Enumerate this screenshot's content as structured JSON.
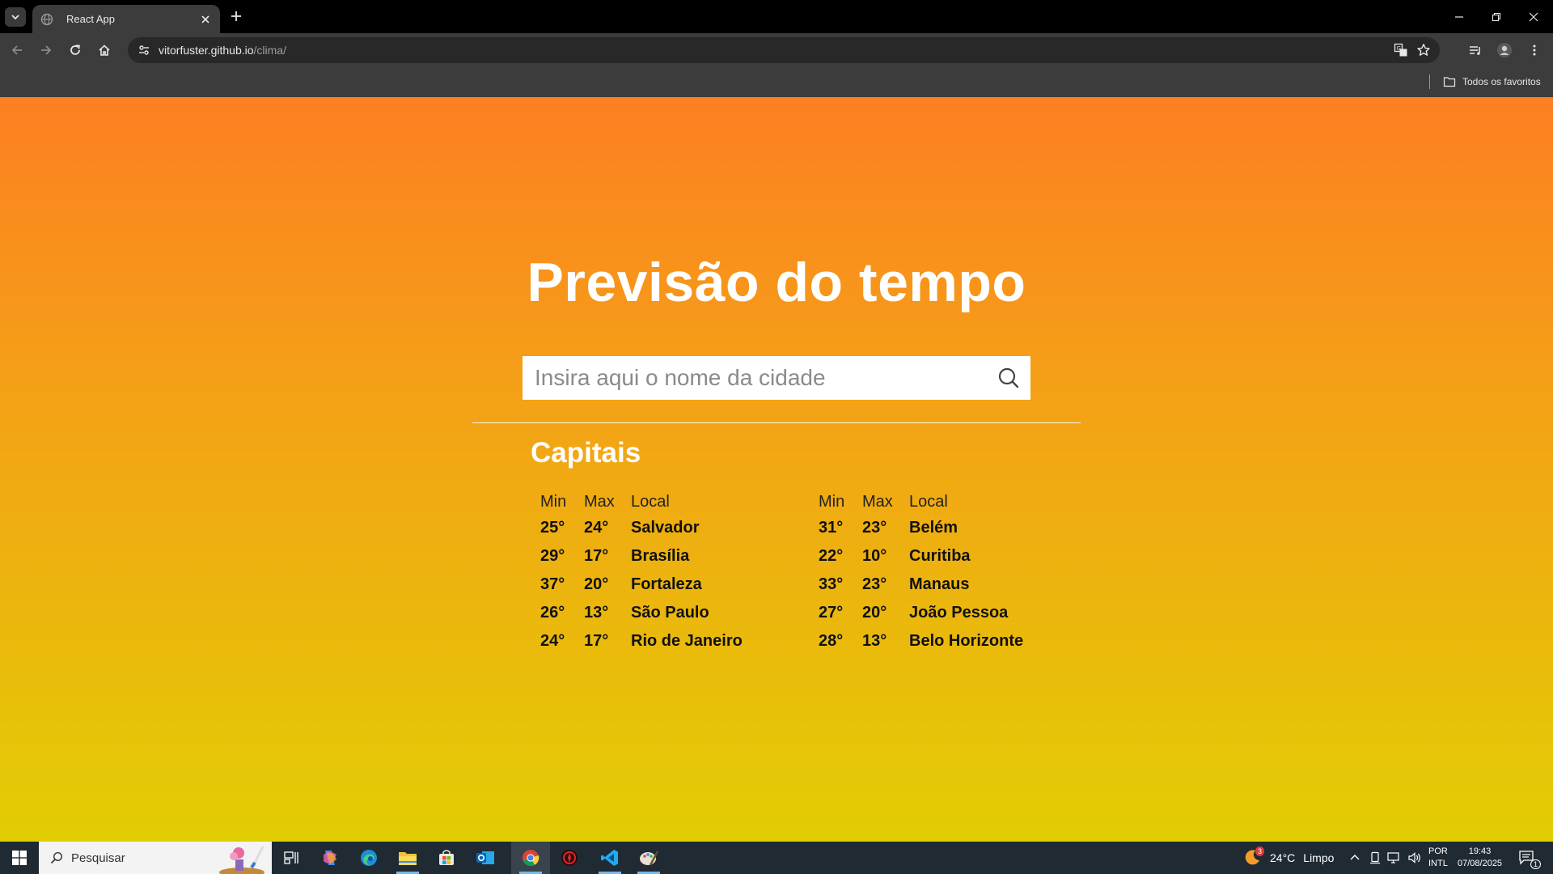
{
  "browser": {
    "tab_title": "React App",
    "url_host": "vitorfuster.github.io",
    "url_path": "/clima/",
    "bookmarks_all": "Todos os favoritos"
  },
  "page": {
    "headline": "Previsão do tempo",
    "search_placeholder": "Insira aqui o nome da cidade",
    "section_title": "Capitais",
    "columns": {
      "min": "Min",
      "max": "Max",
      "local": "Local"
    },
    "capitals_left": [
      {
        "min": "25°",
        "max": "24°",
        "local": "Salvador"
      },
      {
        "min": "29°",
        "max": "17°",
        "local": "Brasília"
      },
      {
        "min": "37°",
        "max": "20°",
        "local": "Fortaleza"
      },
      {
        "min": "26°",
        "max": "13°",
        "local": "São Paulo"
      },
      {
        "min": "24°",
        "max": "17°",
        "local": "Rio de Janeiro"
      }
    ],
    "capitals_right": [
      {
        "min": "31°",
        "max": "23°",
        "local": "Belém"
      },
      {
        "min": "22°",
        "max": "10°",
        "local": "Curitiba"
      },
      {
        "min": "33°",
        "max": "23°",
        "local": "Manaus"
      },
      {
        "min": "27°",
        "max": "20°",
        "local": "João Pessoa"
      },
      {
        "min": "28°",
        "max": "13°",
        "local": "Belo Horizonte"
      }
    ]
  },
  "taskbar": {
    "search_label": "Pesquisar",
    "weather_temp": "24°C",
    "weather_desc": "Limpo",
    "weather_badge": "3",
    "lang_line1": "POR",
    "lang_line2": "INTL",
    "time": "19:43",
    "date": "07/08/2025",
    "notification_count": "1"
  },
  "colors": {
    "gradient_top": "#fd7f22",
    "gradient_bottom": "#e2cd03",
    "headline": "#ffffff",
    "chrome_dark": "#3c3c3c",
    "taskbar": "#202a33"
  },
  "icons": {
    "tab_search": "chevron-down-icon",
    "tab_favicon": "globe-icon",
    "tab_close": "close-icon",
    "new_tab": "plus-icon",
    "back": "arrow-left-icon",
    "forward": "arrow-right-icon",
    "reload": "reload-icon",
    "home": "home-icon",
    "site_info": "tune-icon",
    "translate": "translate-icon",
    "bookmark": "star-icon",
    "media": "media-queue-icon",
    "profile": "profile-icon",
    "menu": "kebab-menu-icon",
    "search": "magnifier-icon"
  }
}
